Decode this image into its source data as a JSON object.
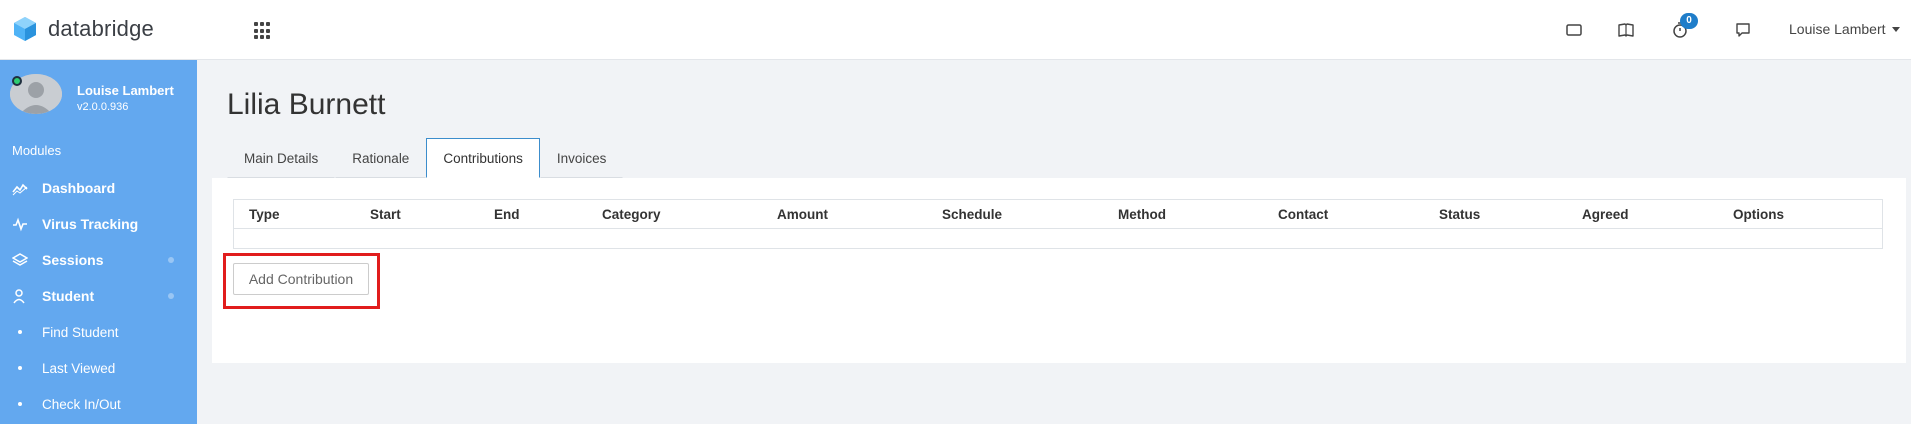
{
  "brand": {
    "name": "databridge"
  },
  "header": {
    "icons": [
      "tablet-icon",
      "book-icon",
      "timer-icon",
      "chat-icon"
    ],
    "timer_badge": "0",
    "user_name": "Louise Lambert"
  },
  "sidebar": {
    "profile_name": "Louise Lambert",
    "version": "v2.0.0.936",
    "section_label": "Modules",
    "items": [
      {
        "label": "Dashboard",
        "icon": "chart-line-icon"
      },
      {
        "label": "Virus Tracking",
        "icon": "pulse-icon"
      },
      {
        "label": "Sessions",
        "icon": "layers-icon"
      },
      {
        "label": "Student",
        "icon": "users-icon"
      },
      {
        "label": "Find Student",
        "icon": "bullet-icon"
      },
      {
        "label": "Last Viewed",
        "icon": "bullet-icon"
      },
      {
        "label": "Check In/Out",
        "icon": "bullet-icon"
      }
    ]
  },
  "main": {
    "title": "Lilia Burnett",
    "tabs": [
      "Main Details",
      "Rationale",
      "Contributions",
      "Invoices"
    ],
    "active_tab": "Contributions",
    "table": {
      "columns": [
        "Type",
        "Start",
        "End",
        "Category",
        "Amount",
        "Schedule",
        "Method",
        "Contact",
        "Status",
        "Agreed",
        "Options"
      ],
      "rows": []
    },
    "add_button": "Add Contribution"
  },
  "colors": {
    "sidebar": "#63a8ef",
    "accent": "#3c8dcc",
    "badge": "#1f7dc9",
    "highlight": "#e11d1d"
  }
}
